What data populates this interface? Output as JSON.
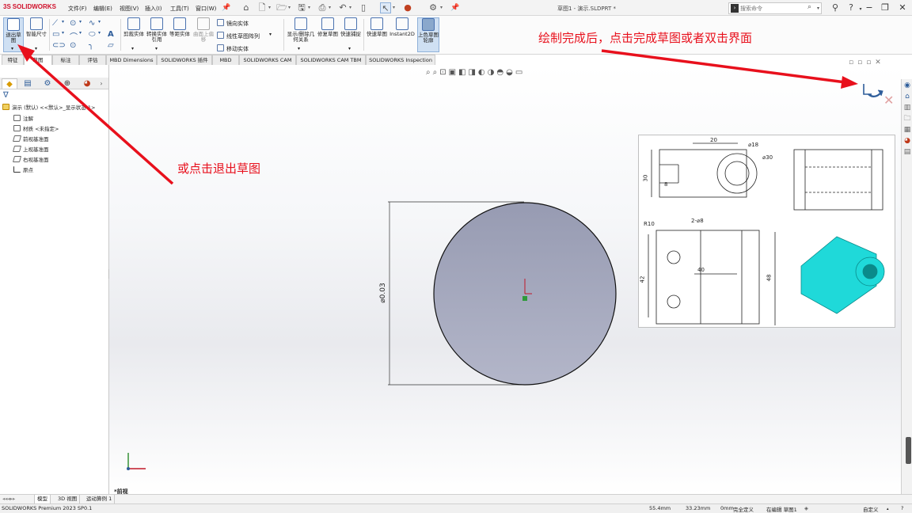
{
  "app": {
    "brand_prefix": "3S",
    "brand": "SOLIDWORKS"
  },
  "menu": [
    "文件(F)",
    "编辑(E)",
    "视图(V)",
    "插入(I)",
    "工具(T)",
    "窗口(W)"
  ],
  "document_title": "草图1 - 演示.SLDPRT *",
  "search": {
    "placeholder": "搜索命令"
  },
  "ribbon": {
    "exit_sketch": "退出草图",
    "smart_dimension": "智能尺寸",
    "trim_entities": "剪裁实体",
    "convert_entities": "转换实体引用",
    "offset_entities": "等距实体",
    "offset_on_surface": "曲面上偏移",
    "mirror_entities": "镜向实体",
    "linear_pattern": "线性草图阵列",
    "move_entities": "移动实体",
    "display_relations": "显示/删除几何关系",
    "repair_sketch": "修复草图",
    "quick_snaps": "快速捕捉",
    "rapid_sketch": "快速草图",
    "instant2d": "Instant2D",
    "shaded_sketch": "上色草图轮廓"
  },
  "tabs": [
    "特征",
    "草图",
    "标注",
    "评估",
    "MBD Dimensions",
    "SOLIDWORKS 插件",
    "MBD",
    "SOLIDWORKS CAM",
    "SOLIDWORKS CAM TBM",
    "SOLIDWORKS Inspection"
  ],
  "tree": {
    "root": "演示 (默认) <<默认>_显示状态 1>",
    "items": [
      "注解",
      "材质 <未指定>",
      "前视基准面",
      "上视基准面",
      "右视基准面",
      "原点"
    ]
  },
  "sketch": {
    "dimension": "⌀0.03"
  },
  "annotations": {
    "top_right": "绘制完成后，点击完成草图或者双击界面",
    "left": "或点击退出草图"
  },
  "drawing_labels": [
    "20",
    "⌀18",
    "⌀30",
    "30",
    "8",
    "R10",
    "2-⌀8",
    "40",
    "42",
    "48"
  ],
  "precision_label": "*前视",
  "bottom_tabs": [
    "模型",
    "3D 视图",
    "运动算例 1"
  ],
  "status": {
    "product": "SOLIDWORKS Premium 2023 SP0.1",
    "x": "55.4mm",
    "y": "33.23mm",
    "z": "0mm",
    "state": "完全定义",
    "editing": "在编辑 草图1",
    "units": "自定义"
  },
  "colors": {
    "accent": "#e8101c",
    "circle_fill": "#9a9db4",
    "brand": "#d0102a"
  }
}
